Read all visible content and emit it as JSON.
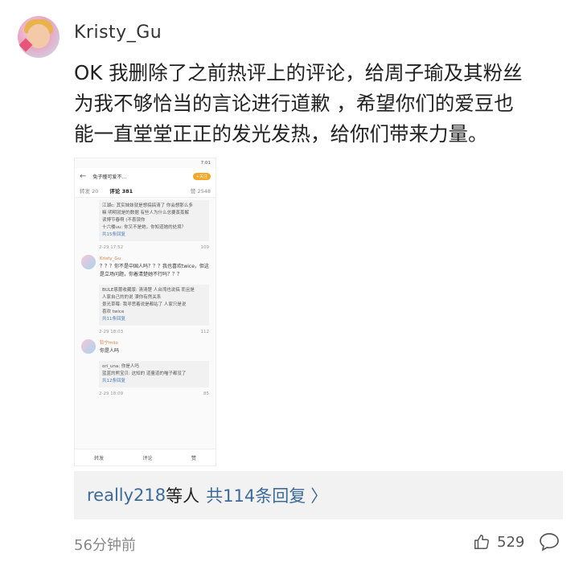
{
  "post": {
    "username": "Kristy_Gu",
    "text": "OK 我删除了之前热评上的评论，给周子瑜及其粉丝\n为我不够恰当的言论进行道歉 ，希望你们的爱豆也\n能一直堂堂正正的发光发热，给你们带来力量。"
  },
  "screenshot": {
    "status_time": "7:01",
    "title": "兔子瞳可爱不...",
    "badge": "+关注",
    "tabs": {
      "repost": "转发 20",
      "comments": "评论 381",
      "likes": "赞 2548"
    },
    "thread1": {
      "lines": [
        "江湖c: 其实妹妹就是想搞搞清了 你会想那么多",
        "嘛 明明就是的数据 有些人为什么总要蒸蒸解",
        "读博节春啊 (不喜误你",
        "十六楼uu: 你又不是她，你知道她的处境？"
      ],
      "more": "共15条回复",
      "time": "2-29 17:52",
      "likes": "109"
    },
    "comment": {
      "name": "Kristy_Gu",
      "text": "？？？你不是中国人吗？？？我也喜欢twice，但这是立场问题，你着清楚她不行吗？？？"
    },
    "thread2": {
      "lines": [
        "BULE恩蕾收藏版: 清清楚 人台湾也说搞 而且是",
        "人家自己的的说 漂你有然关系",
        "景光草莓: 我寻思着说是都站了 人家只是说",
        "喜欢 twice"
      ],
      "more": "共11条回复",
      "time": "2-29 18:03",
      "likes": "112"
    },
    "comment2": {
      "name": "铃宁miio",
      "text": "你是人吗"
    },
    "thread3": {
      "lines": [
        "ori_una: 你是人吗",
        "蓝蓝的熊宝贝: 这知的 道量道的喵子都没了"
      ],
      "more": "共12条回复",
      "time": "2-29 18:09",
      "likes": "85"
    },
    "bottom": {
      "repost": "转发",
      "comment": "评论",
      "like": "赞"
    }
  },
  "replies": {
    "who": "really218",
    "tail": "等人",
    "count": "共114条回复",
    "chevron": "〉"
  },
  "footer": {
    "time": "56分钟前",
    "likes": "529"
  }
}
